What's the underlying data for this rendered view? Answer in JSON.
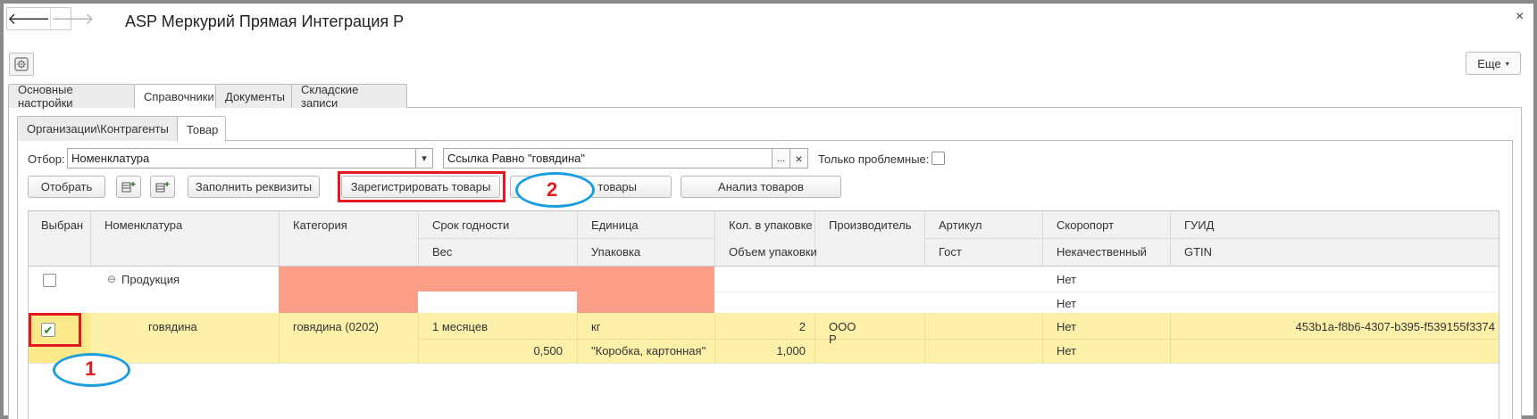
{
  "window": {
    "title": "ASP Меркурий Прямая Интеграция Р",
    "back_glyph": "🡐",
    "forward_glyph": "🡒",
    "close_glyph": "×",
    "more_label": "Еще",
    "more_caret": "▾"
  },
  "outer_tabs": [
    "Основные настройки",
    "Справочники",
    "Документы",
    "Складские записи"
  ],
  "inner_tabs": [
    "Организации\\Контрагенты",
    "Товар"
  ],
  "filter": {
    "label": "Отбор:",
    "field_value": "Номенклатура",
    "field_dropdown": "▾",
    "condition_value": "Ссылка Равно \"говядина\"",
    "condition_more": "...",
    "condition_clear": "×",
    "problem_label": "Только проблемные:"
  },
  "toolbar": {
    "select_label": "Отобрать",
    "fill_label": "Заполнить реквизиты",
    "register_label": "Зарегистрировать товары",
    "hidden_button_label": "товары",
    "analysis_label": "Анализ товаров"
  },
  "annotations": {
    "marker_1": "1",
    "marker_2": "2"
  },
  "table": {
    "header_row1": [
      "Выбран",
      "Номенклатура",
      "Категория",
      "Срок годности",
      "Единица",
      "Кол. в упаковке",
      "Производитель",
      "Артикул",
      "Скоропорт",
      "ГУИД"
    ],
    "header_row2": [
      "",
      "",
      "",
      "Вес",
      "Упаковка",
      "Объем упаковки",
      "",
      "Гост",
      "Некачественный",
      "GTIN"
    ],
    "group_row": {
      "expand_glyph": "⊖",
      "name": "Продукция",
      "perishable": "Нет",
      "defective": "Нет"
    },
    "item_row": {
      "checked_glyph": "✔",
      "name": "говядина",
      "category": "говядина (0202)",
      "shelf_life": "1 месяцев",
      "weight": "0,500",
      "unit": "кг",
      "package": "\"Коробка, картонная\"",
      "qty_in_package": "2",
      "package_volume": "1,000",
      "manufacturer_line1": "ООО",
      "manufacturer_line2": "Р",
      "perishable": "Нет",
      "defective": "Нет",
      "guid": "453b1a-f8b6-4307-b395-f539155f3374"
    }
  },
  "colors": {
    "selected_row": "#fdf1a9",
    "selected_row_cell": "#fbe98a",
    "error_cell": "#fb9e88",
    "annotation_red": "#e3191f",
    "annotation_blue": "#1b9ee0"
  }
}
